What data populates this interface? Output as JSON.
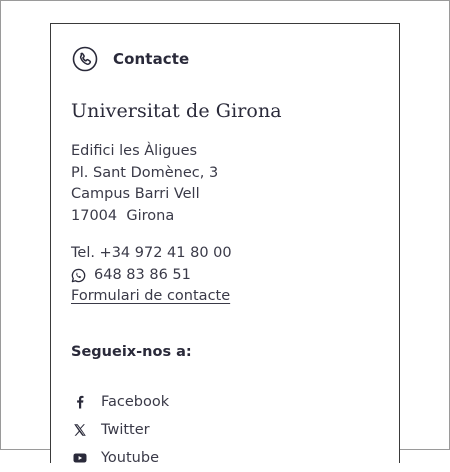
{
  "header": {
    "title": "Contacte",
    "icon": "phone-icon"
  },
  "organization": {
    "name": "Universitat de Girona"
  },
  "address": {
    "lines": [
      "Edifici les Àligues",
      "Pl. Sant Domènec, 3",
      "Campus Barri Vell",
      "17004  Girona"
    ]
  },
  "contact": {
    "phone": "Tel. +34 972 41 80 00",
    "whatsapp": "648 83 86 51",
    "form_link": "Formulari de contacte"
  },
  "social": {
    "title": "Segueix-nos a:",
    "items": [
      {
        "label": "Facebook",
        "icon": "facebook-icon"
      },
      {
        "label": "Twitter",
        "icon": "x-twitter-icon"
      },
      {
        "label": "Youtube",
        "icon": "youtube-icon"
      }
    ]
  },
  "colors": {
    "text": "#2a2a3a",
    "border": "#3a3a3a"
  }
}
